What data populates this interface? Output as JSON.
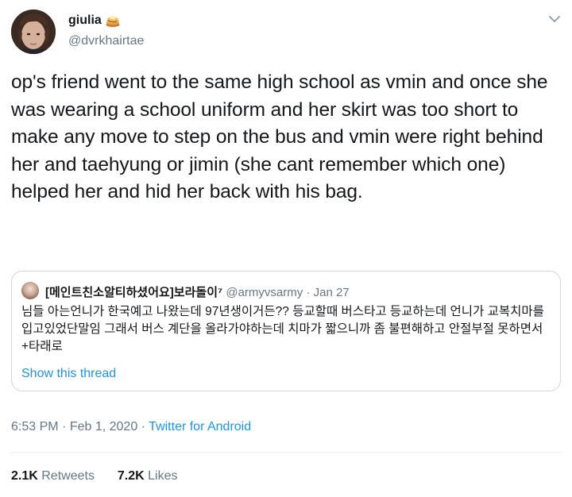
{
  "tweet": {
    "display_name": "giulia",
    "name_emoji": "pancakes-icon",
    "handle": "@dvrkhairtae",
    "text": "op's friend went to the same high school as vmin and once she was wearing a school uniform and her skirt was too short to make any move to step on the bus and vmin were right behind her and taehyung or jimin (she cant remember which one) helped her and hid her back with his bag.",
    "time": "6:53 PM",
    "date": "Feb 1, 2020",
    "client": "Twitter for Android",
    "retweets_count": "2.1K",
    "retweets_label": "Retweets",
    "likes_count": "7.2K",
    "likes_label": "Likes"
  },
  "quoted": {
    "display_name": "[메인트친소알티하셨어요]보라돌이⁷",
    "handle": "@armyvsarmy",
    "date": "Jan 27",
    "text": "님들 아는언니가 한국예고 나왔는데 97년생이거든?? 등교할때 버스타고 등교하는데 언니가 교복치마를 입고있었단말임 그래서 버스 계단을 올라가야하는데 치마가 짧으니까 좀 불편해하고 안절부절 못하면서 +타래로",
    "show_thread": "Show this thread"
  },
  "separators": {
    "meta": "·"
  },
  "colors": {
    "text": "#14171a",
    "secondary": "#657786",
    "link": "#1b95e0",
    "border": "#ccd6dd"
  }
}
